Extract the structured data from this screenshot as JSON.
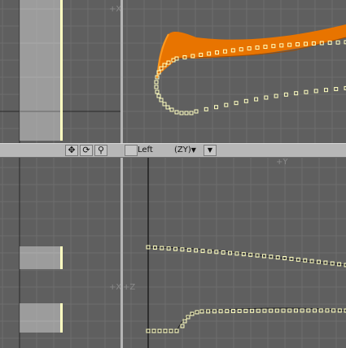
{
  "viewports": {
    "top_left": {
      "axis_label": "+X"
    },
    "bottom_left": {
      "axis_label": "+X"
    },
    "bottom_right": {
      "axis_label_top": "+Y",
      "axis_label_left": "+Z"
    }
  },
  "toolbar": {
    "left_icons": [
      "move-icon",
      "rotate-icon",
      "zoom-icon"
    ],
    "view_name": "Left",
    "view_axes": "(ZY)",
    "dropdown_arrow": "▼"
  },
  "colors": {
    "background": "#5f5f5f",
    "grid": "#6a6a6a",
    "grid_major": "#4a4a4a",
    "point": "#ffffc0",
    "curve_orange": "#e87400"
  }
}
